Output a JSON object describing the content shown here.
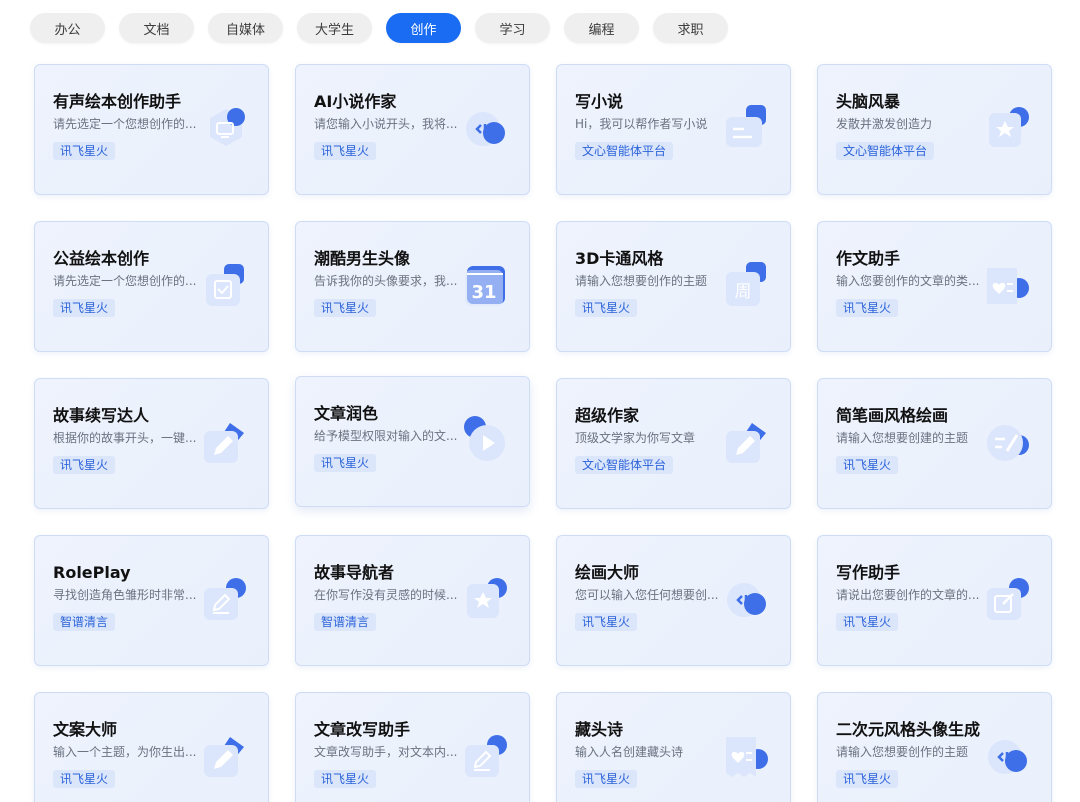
{
  "tabs": [
    {
      "label": "办公",
      "active": false
    },
    {
      "label": "文档",
      "active": false
    },
    {
      "label": "自媒体",
      "active": false
    },
    {
      "label": "大学生",
      "active": false
    },
    {
      "label": "创作",
      "active": true
    },
    {
      "label": "学习",
      "active": false
    },
    {
      "label": "编程",
      "active": false
    },
    {
      "label": "求职",
      "active": false
    }
  ],
  "cards": [
    {
      "title": "有声绘本创作助手",
      "desc": "请先选定一个您想创作的...",
      "badge": "讯飞星火",
      "icon": "monitor-icon"
    },
    {
      "title": "AI小说作家",
      "desc": "请您输入小说开头，我将...",
      "badge": "讯飞星火",
      "icon": "code-bubble-icon"
    },
    {
      "title": "写小说",
      "desc": "Hi，我可以帮作者写小说",
      "badge": "文心智能体平台",
      "icon": "message-lines-icon"
    },
    {
      "title": "头脑风暴",
      "desc": "发散并激发创造力",
      "badge": "文心智能体平台",
      "icon": "star-document-icon"
    },
    {
      "title": "公益绘本创作",
      "desc": "请先选定一个您想创作的...",
      "badge": "讯飞星火",
      "icon": "clipboard-check-icon"
    },
    {
      "title": "潮酷男生头像",
      "desc": "告诉我你的头像要求，我...",
      "badge": "讯飞星火",
      "icon": "calendar-31-icon"
    },
    {
      "title": "3D卡通风格",
      "desc": "请输入您想要创作的主题",
      "badge": "讯飞星火",
      "icon": "week-calendar-icon"
    },
    {
      "title": "作文助手",
      "desc": "输入您要创作的文章的类...",
      "badge": "讯飞星火",
      "icon": "heart-list-icon"
    },
    {
      "title": "故事续写达人",
      "desc": "根据你的故事开头，一键...",
      "badge": "讯飞星火",
      "icon": "pencil-icon"
    },
    {
      "title": "文章润色",
      "desc": "给予模型权限对输入的文...",
      "badge": "讯飞星火",
      "icon": "play-circle-icon"
    },
    {
      "title": "超级作家",
      "desc": "顶级文学家为你写文章",
      "badge": "文心智能体平台",
      "icon": "pencil-icon"
    },
    {
      "title": "简笔画风格绘画",
      "desc": "请输入您想要创建的主题",
      "badge": "讯飞星火",
      "icon": "edit-lines-icon"
    },
    {
      "title": "RolePlay",
      "desc": "寻找创造角色雏形时非常...",
      "badge": "智谱清言",
      "icon": "edit-square-icon"
    },
    {
      "title": "故事导航者",
      "desc": "在你写作没有灵感的时候...",
      "badge": "智谱清言",
      "icon": "star-document-icon"
    },
    {
      "title": "绘画大师",
      "desc": "您可以输入您任何想要创...",
      "badge": "讯飞星火",
      "icon": "code-bubble-icon"
    },
    {
      "title": "写作助手",
      "desc": "请说出您要创作的文章的...",
      "badge": "讯飞星火",
      "icon": "edit-box-icon"
    },
    {
      "title": "文案大师",
      "desc": "输入一个主题，为你生出...",
      "badge": "讯飞星火",
      "icon": "pencil-icon"
    },
    {
      "title": "文章改写助手",
      "desc": "文章改写助手，对文本内...",
      "badge": "讯飞星火",
      "icon": "edit-square-icon"
    },
    {
      "title": "藏头诗",
      "desc": "输入人名创建藏头诗",
      "badge": "讯飞星火",
      "icon": "heart-ticket-icon"
    },
    {
      "title": "二次元风格头像生成",
      "desc": "请输入您想要创作的主题",
      "badge": "讯飞星火",
      "icon": "code-bubble-icon"
    }
  ],
  "colors": {
    "accent": "#1a6cf3",
    "card_bg": "#eef3fd",
    "badge_bg": "#dbe6fb",
    "badge_text": "#2b63d9"
  }
}
